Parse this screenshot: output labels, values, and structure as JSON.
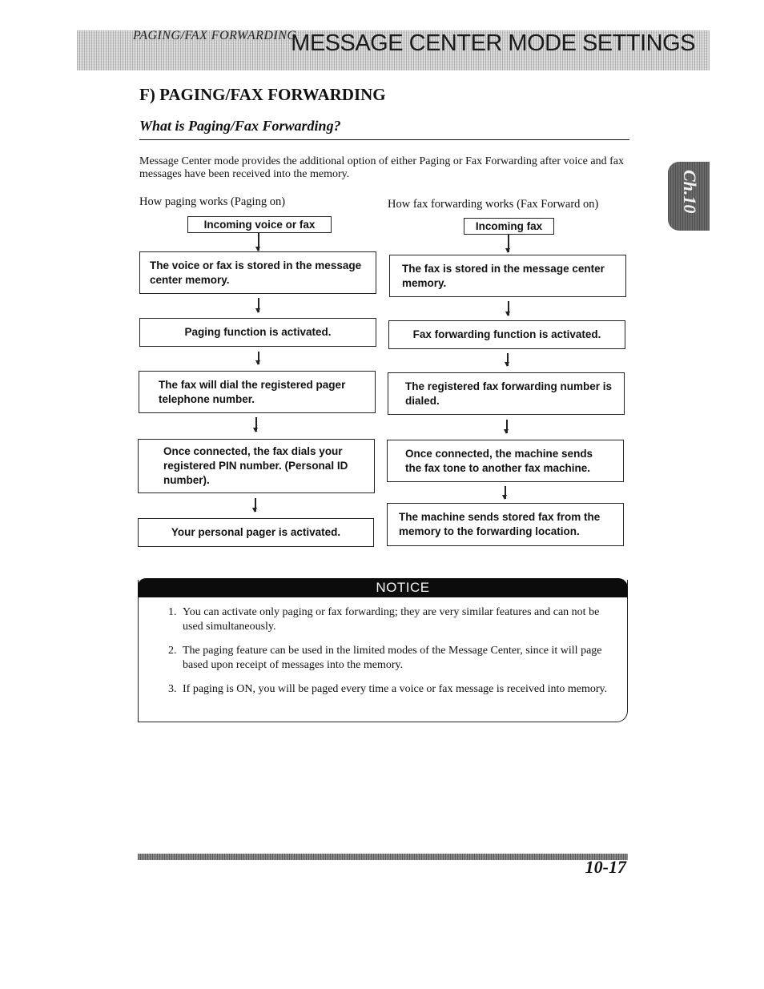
{
  "header": {
    "section_label": "PAGING/FAX FORWARDING",
    "title": "MESSAGE CENTER MODE SETTINGS"
  },
  "chapter_tab": "Ch.10",
  "heading": "F) PAGING/FAX FORWARDING",
  "subheading": "What is Paging/Fax Forwarding?",
  "intro": "Message Center mode provides the additional option of either Paging or Fax Forwarding after voice and fax messages have been received into the memory.",
  "paging_flow": {
    "caption": "How paging works (Paging on)",
    "steps": [
      "Incoming voice or fax",
      "The voice or fax is stored in the message center memory.",
      "Paging function is activated.",
      "The fax will dial the registered pager telephone number.",
      "Once connected, the fax dials your registered PIN number. (Personal ID number).",
      "Your personal pager is activated."
    ]
  },
  "fax_flow": {
    "caption": "How fax forwarding works (Fax Forward on)",
    "steps": [
      "Incoming fax",
      "The fax is stored in the message center memory.",
      "Fax forwarding function is activated.",
      "The registered fax forwarding number is dialed.",
      "Once connected, the machine sends the fax tone to another fax machine.",
      "The machine sends stored fax from the memory to the forwarding location."
    ]
  },
  "notice": {
    "title": "NOTICE",
    "items": [
      {
        "num": "1.",
        "text": "You can activate only paging or fax forwarding; they are very similar features and can not be used simultaneously."
      },
      {
        "num": "2.",
        "text": "The paging feature can be used in the limited modes of the Message Center, since it will page based upon receipt of messages into the memory."
      },
      {
        "num": "3.",
        "text": "If paging is ON, you will be paged every time a voice or fax message is received into memory."
      }
    ]
  },
  "page_number": "10-17"
}
